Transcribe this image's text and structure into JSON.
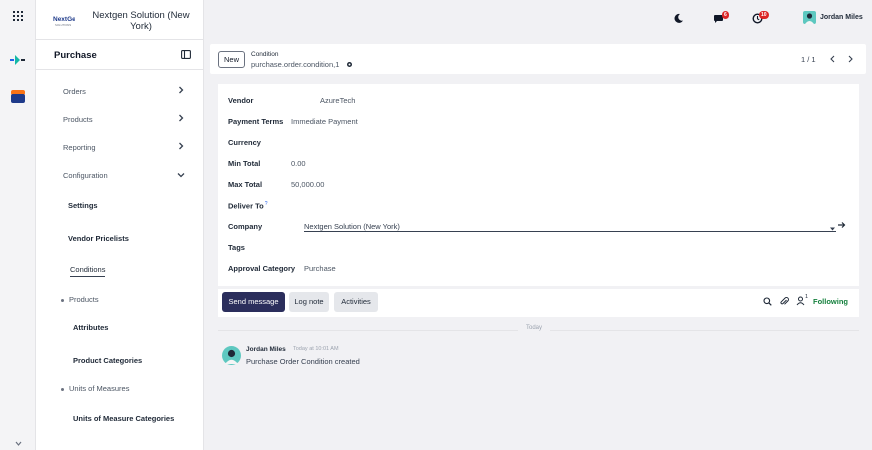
{
  "sidebar": {
    "company": "Nextgen Solution (New York)",
    "logo_text": "NextGen",
    "logo_sub": "SOLUTIONS",
    "app_title": "Purchase",
    "menu": [
      {
        "label": "Orders"
      },
      {
        "label": "Products"
      },
      {
        "label": "Reporting"
      },
      {
        "label": "Configuration"
      }
    ],
    "config_items": [
      {
        "label": "Settings"
      },
      {
        "label": "Vendor Pricelists"
      },
      {
        "label": "Conditions"
      },
      {
        "label": "Products"
      },
      {
        "label": "Attributes"
      },
      {
        "label": "Product Categories"
      },
      {
        "label": "Units of Measures"
      },
      {
        "label": "Units of Measure Categories"
      }
    ]
  },
  "topbar": {
    "messages_count": "6",
    "activities_count": "10",
    "user_name": "Jordan Miles"
  },
  "control_panel": {
    "new_label": "New",
    "breadcrumb_title": "Condition",
    "record_name": "purchase.order.condition,1",
    "pager": "1 / 1"
  },
  "form": {
    "fields": [
      {
        "label": "Vendor",
        "value": "AzureTech"
      },
      {
        "label": "Payment Terms",
        "value": "Immediate Payment"
      },
      {
        "label": "Currency",
        "value": ""
      },
      {
        "label": "Min Total",
        "value": "0.00"
      },
      {
        "label": "Max Total",
        "value": "50,000.00"
      },
      {
        "label": "Deliver To",
        "value": "",
        "help": "?"
      },
      {
        "label": "Company",
        "value": "Nextgen Solution (New York)"
      },
      {
        "label": "Tags",
        "value": ""
      },
      {
        "label": "Approval Category",
        "value": "Purchase"
      }
    ]
  },
  "chatter": {
    "send_message": "Send message",
    "log_note": "Log note",
    "activities": "Activities",
    "followers_count": "1",
    "following": "Following",
    "date_separator": "Today",
    "message": {
      "author": "Jordan Miles",
      "time": "Today at 10:01 AM",
      "body": "Purchase Order Condition created"
    }
  },
  "colors": {
    "primary_button": "#2b2e5c",
    "following": "#15803d",
    "badge": "#dc2626",
    "avatar": "#5ec8c0"
  }
}
